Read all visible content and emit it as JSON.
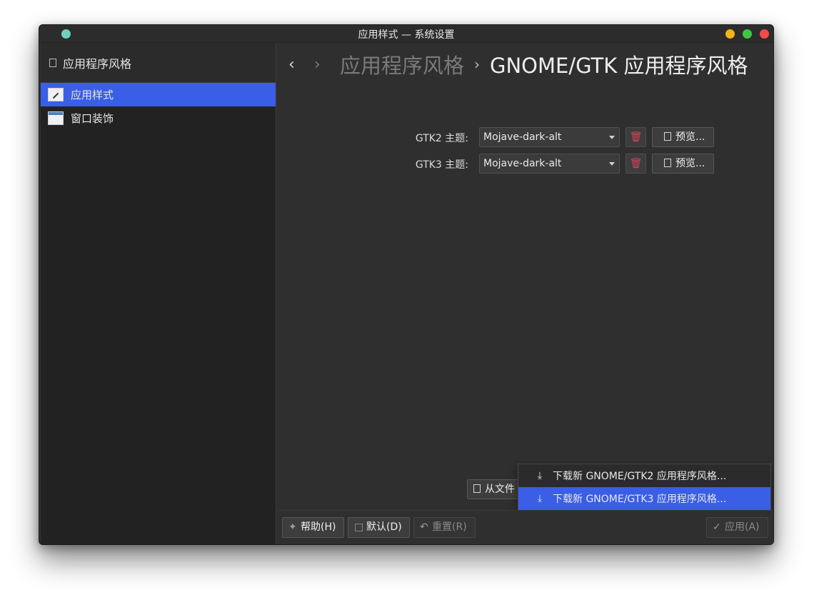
{
  "window": {
    "title": "应用样式 — 系统设置"
  },
  "sidebar": {
    "header": "应用程序风格",
    "items": [
      {
        "label": "应用样式",
        "selected": true
      },
      {
        "label": "窗口装饰",
        "selected": false
      }
    ]
  },
  "breadcrumb": {
    "parent": "应用程序风格",
    "current": "GNOME/GTK 应用程序风格"
  },
  "gtk2": {
    "label": "GTK2 主题:",
    "value": "Mojave-dark-alt",
    "preview_label": "预览..."
  },
  "gtk3": {
    "label": "GTK3 主题:",
    "value": "Mojave-dark-alt",
    "preview_label": "预览..."
  },
  "from_file_label": "从文件",
  "popup": {
    "items": [
      {
        "label": "下载新 GNOME/GTK2 应用程序风格..."
      },
      {
        "label": "下载新 GNOME/GTK3 应用程序风格..."
      }
    ]
  },
  "footer": {
    "help": "帮助(H)",
    "defaults": "默认(D)",
    "reset": "重置(R)",
    "apply": "应用(A)"
  },
  "colors": {
    "accent": "#3a5ee6",
    "background": "#2f2f2f",
    "sidebar_bg": "#222222"
  }
}
